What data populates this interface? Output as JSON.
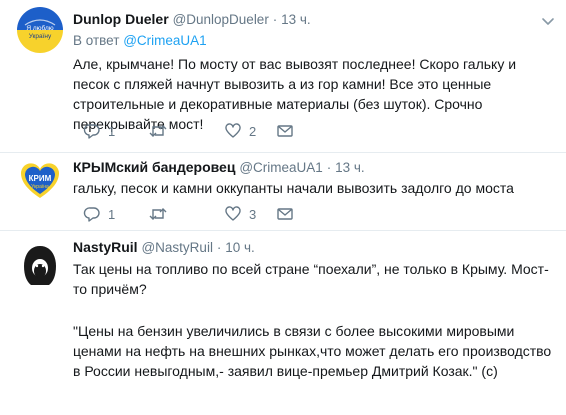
{
  "tweets": [
    {
      "name": "Dunlop Dueler",
      "handle": "@DunlopDueler",
      "dot": "·",
      "time": "13 ч.",
      "reply_label": "В ответ",
      "reply_handle": "@CrimeaUA1",
      "avatar_text": "Я люблю Україну",
      "text": "Але, крымчане! По мосту от вас вывозят последнее! Скоро гальку и песок с пляжей начнут вывозить а из гор камни! Все это ценные строительные и декоративные материалы (без шуток). Срочно перекрывайте мост!",
      "replies": "1",
      "retweets": "",
      "likes": "2"
    },
    {
      "name": "КРЫМский бандеровец",
      "handle": "@CrimeaUA1",
      "dot": "·",
      "time": "13 ч.",
      "avatar_text": "КРИМ Україна",
      "text": "гальку, песок и камни оккупанты начали вывозить задолго до моста",
      "replies": "1",
      "retweets": "",
      "likes": "3"
    },
    {
      "name": "NastyRuil",
      "handle": "@NastyRuil",
      "dot": "·",
      "time": "10 ч.",
      "text_p1": "Так цены на топливо по всей стране “поехали”, не только в Крыму. Мост-то причём?",
      "text_p2": "\"Цены на бензин увеличились в связи с более высокими мировыми ценами на  нефть на внешних рынках,что может делать его производство в России невыгодным,- заявил вице-премьер Дмитрий Козак.\" (c)"
    }
  ],
  "colors": {
    "link": "#1da1f2",
    "secondary": "#657786",
    "divider": "#e6ecf0",
    "ukraine_blue": "#1d5fc9",
    "ukraine_yellow": "#f7d22c"
  }
}
